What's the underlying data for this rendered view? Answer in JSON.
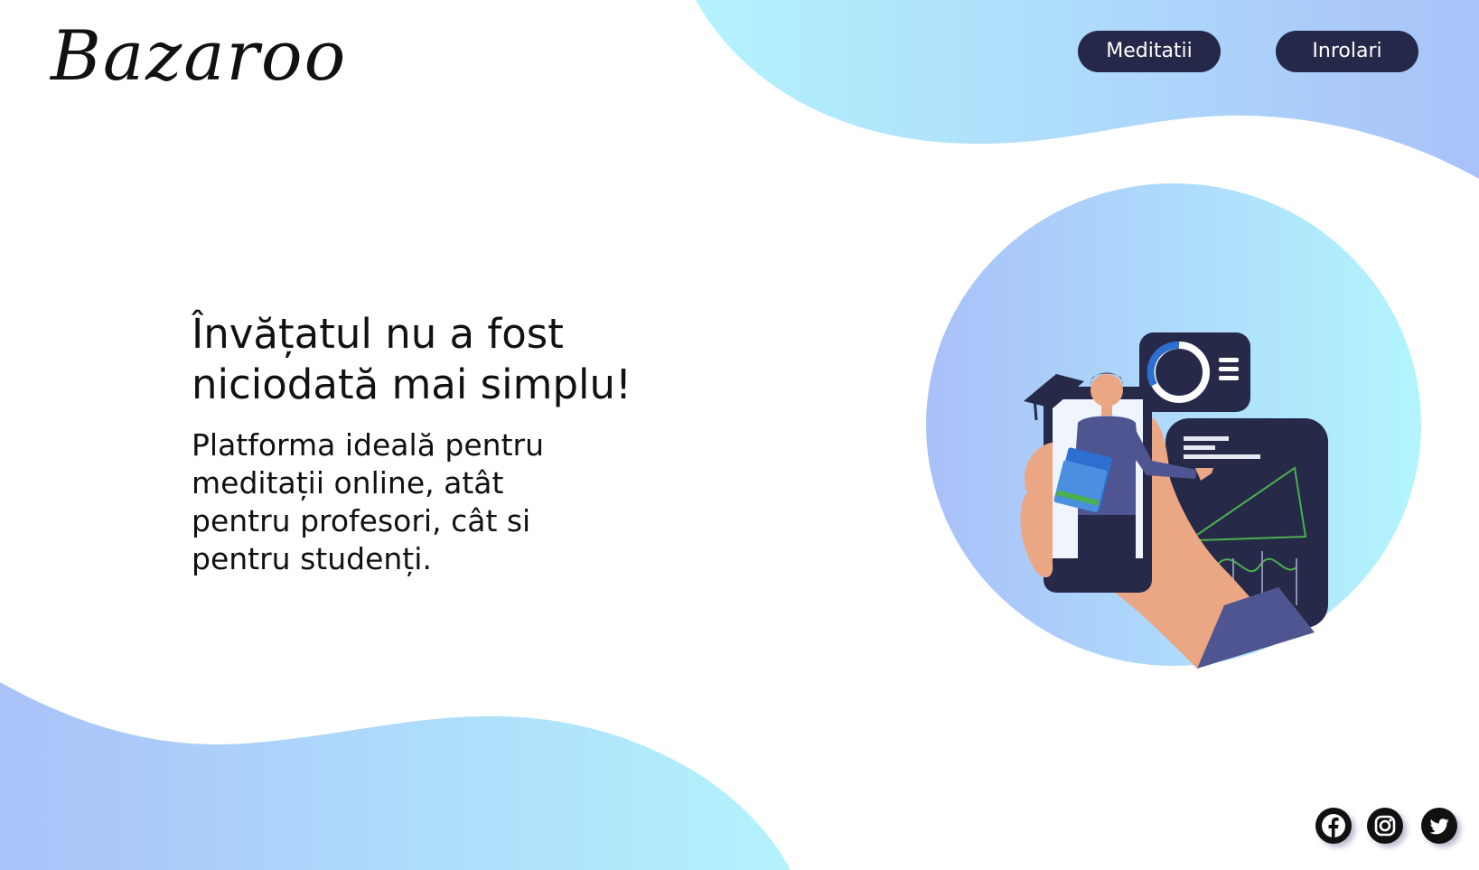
{
  "brand": {
    "logo_text": "Bazaroo"
  },
  "nav": {
    "meditatii_label": "Meditatii",
    "inrolari_label": "Inrolari"
  },
  "hero": {
    "headline": "Învățatul nu a fost niciodată mai simplu!",
    "subtext": "Platforma ideală pentru meditații online, atât pentru profesori, cât si pentru studenți."
  },
  "social": {
    "icons": [
      "facebook-icon",
      "instagram-icon",
      "twitter-icon"
    ]
  },
  "colors": {
    "nav_button_bg": "#252848",
    "gradient_start": "#a9c2f9",
    "gradient_end": "#b3f3fd",
    "illustration_dark": "#262a48",
    "text": "#111111"
  }
}
